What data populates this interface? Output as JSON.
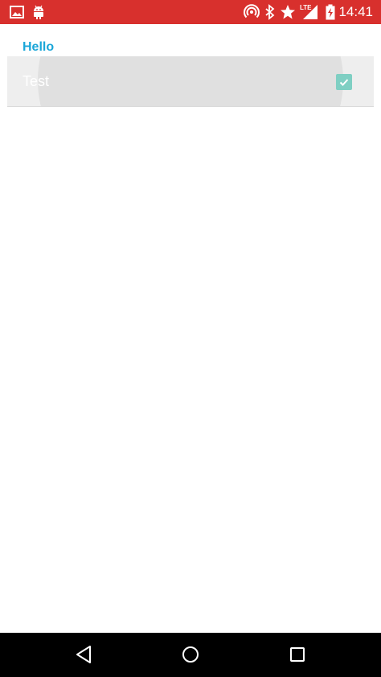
{
  "status_bar": {
    "time": "14:41",
    "network_label": "LTE",
    "color": "#d8302d",
    "left_icons": [
      "image-icon",
      "android-icon"
    ],
    "right_icons": [
      "hotspot-icon",
      "bluetooth-icon",
      "star-icon",
      "signal-icon",
      "battery-icon"
    ]
  },
  "preferences": {
    "category_title": "Hello",
    "items": [
      {
        "title": "Test",
        "checked": true
      }
    ]
  },
  "nav_bar": {
    "buttons": [
      "back-icon",
      "home-icon",
      "recents-icon"
    ]
  },
  "colors": {
    "accent": "#1aa6d8",
    "checkbox": "#7fcfc3"
  }
}
